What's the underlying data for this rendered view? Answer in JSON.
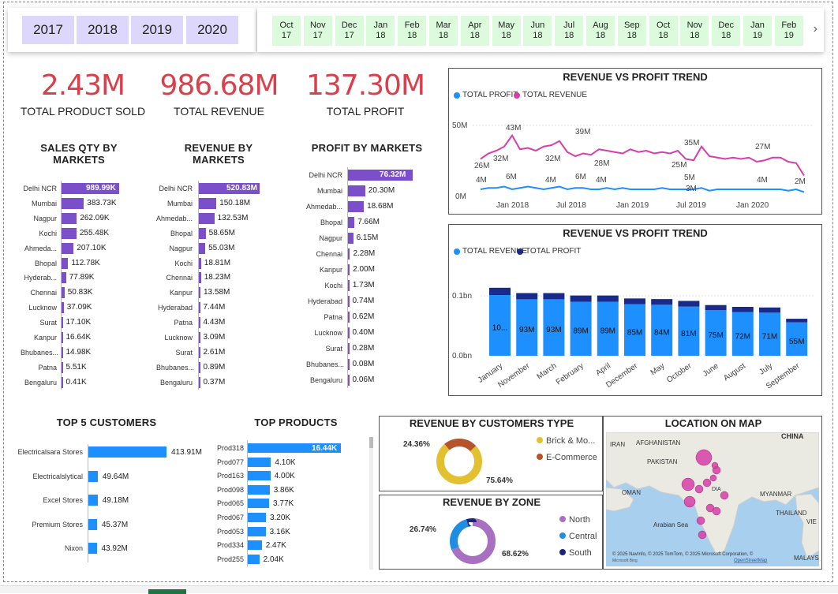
{
  "years": [
    "2017",
    "2018",
    "2019",
    "2020"
  ],
  "months": [
    [
      "Oct",
      "17"
    ],
    [
      "Nov",
      "17"
    ],
    [
      "Dec",
      "17"
    ],
    [
      "Jan",
      "18"
    ],
    [
      "Feb",
      "18"
    ],
    [
      "Mar",
      "18"
    ],
    [
      "Apr",
      "18"
    ],
    [
      "May",
      "18"
    ],
    [
      "Jun",
      "18"
    ],
    [
      "Jul",
      "18"
    ],
    [
      "Aug",
      "18"
    ],
    [
      "Sep",
      "18"
    ],
    [
      "Oct",
      "18"
    ],
    [
      "Nov",
      "18"
    ],
    [
      "Dec",
      "18"
    ],
    [
      "Jan",
      "19"
    ],
    [
      "Feb",
      "19"
    ]
  ],
  "kpis": [
    {
      "value": "2.43M",
      "label": "TOTAL PRODUCT SOLD"
    },
    {
      "value": "986.68M",
      "label": "TOTAL REVENUE"
    },
    {
      "value": "137.30M",
      "label": "TOTAL PROFIT"
    }
  ],
  "sales_qty": {
    "title": "SALES QTY BY MARKETS",
    "items": [
      [
        "Delhi NCR",
        "989.99K",
        989.99
      ],
      [
        "Mumbai",
        "383.73K",
        383.73
      ],
      [
        "Nagpur",
        "262.09K",
        262.09
      ],
      [
        "Kochi",
        "255.48K",
        255.48
      ],
      [
        "Ahmeda...",
        "207.10K",
        207.1
      ],
      [
        "Bhopal",
        "112.78K",
        112.78
      ],
      [
        "Hyderab...",
        "77.89K",
        77.89
      ],
      [
        "Chennai",
        "50.83K",
        50.83
      ],
      [
        "Lucknow",
        "37.09K",
        37.09
      ],
      [
        "Surat",
        "17.10K",
        17.1
      ],
      [
        "Kanpur",
        "16.64K",
        16.64
      ],
      [
        "Bhubanes...",
        "14.98K",
        14.98
      ],
      [
        "Patna",
        "5.51K",
        5.51
      ],
      [
        "Bengaluru",
        "0.41K",
        0.41
      ]
    ]
  },
  "revenue_markets": {
    "title": "REVENUE BY MARKETS",
    "items": [
      [
        "Delhi NCR",
        "520.83M",
        520.83
      ],
      [
        "Mumbai",
        "150.18M",
        150.18
      ],
      [
        "Ahmedab...",
        "132.53M",
        132.53
      ],
      [
        "Bhopal",
        "58.65M",
        58.65
      ],
      [
        "Nagpur",
        "55.03M",
        55.03
      ],
      [
        "Kochi",
        "18.81M",
        18.81
      ],
      [
        "Chennai",
        "18.23M",
        18.23
      ],
      [
        "Kanpur",
        "13.58M",
        13.58
      ],
      [
        "Hyderabad",
        "7.44M",
        7.44
      ],
      [
        "Patna",
        "4.43M",
        4.43
      ],
      [
        "Lucknow",
        "3.09M",
        3.09
      ],
      [
        "Surat",
        "2.61M",
        2.61
      ],
      [
        "Bhubanes...",
        "0.89M",
        0.89
      ],
      [
        "Bengaluru",
        "0.37M",
        0.37
      ]
    ]
  },
  "profit_markets": {
    "title": "PROFIT BY MARKETS",
    "items": [
      [
        "Delhi NCR",
        "76.32M",
        76.32
      ],
      [
        "Mumbai",
        "20.30M",
        20.3
      ],
      [
        "Ahmedab...",
        "18.68M",
        18.68
      ],
      [
        "Bhopal",
        "7.66M",
        7.66
      ],
      [
        "Nagpur",
        "6.15M",
        6.15
      ],
      [
        "Chennai",
        "2.28M",
        2.28
      ],
      [
        "Kanpur",
        "2.00M",
        2.0
      ],
      [
        "Kochi",
        "1.73M",
        1.73
      ],
      [
        "Hyderabad",
        "0.74M",
        0.74
      ],
      [
        "Patna",
        "0.62M",
        0.62
      ],
      [
        "Lucknow",
        "0.40M",
        0.4
      ],
      [
        "Surat",
        "0.28M",
        0.28
      ],
      [
        "Bhubanes...",
        "0.08M",
        0.08
      ],
      [
        "Bengaluru",
        "0.06M",
        0.06
      ]
    ]
  },
  "trend_line": {
    "title": "REVENUE VS PROFIT TREND",
    "legend": [
      "TOTAL PROFIT",
      "TOTAL REVENUE"
    ],
    "yticks": [
      "50M",
      "0M"
    ],
    "xticks": [
      "Jan 2018",
      "Jul 2018",
      "Jan 2019",
      "Jul 2019",
      "Jan 2020"
    ],
    "revenue_labels": [
      "26M",
      "32M",
      "43M",
      "32M",
      "39M",
      "28M",
      "35M",
      "25M",
      "27M",
      "2M"
    ],
    "profit_labels": [
      "4M",
      "6M",
      "4M",
      "6M",
      "4M",
      "5M",
      "3M",
      "4M"
    ]
  },
  "trend_bar": {
    "title": "REVENUE VS PROFIT TREND",
    "legend": [
      "TOTAL REVENUE",
      "TOTAL PROFIT"
    ],
    "yticks": [
      "0.1bn",
      "0.0bn"
    ],
    "months": [
      "January",
      "November",
      "March",
      "February",
      "April",
      "December",
      "May",
      "October",
      "June",
      "August",
      "July",
      "September"
    ],
    "labels": [
      "10...",
      "93M",
      "93M",
      "89M",
      "89M",
      "85M",
      "84M",
      "81M",
      "75M",
      "72M",
      "71M",
      "55M"
    ],
    "revenue": [
      100,
      93,
      93,
      89,
      89,
      85,
      84,
      81,
      75,
      72,
      71,
      55
    ],
    "profit": [
      14,
      12,
      12,
      12,
      12,
      11,
      11,
      11,
      10,
      10,
      10,
      7
    ]
  },
  "top_customers": {
    "title": "TOP 5 CUSTOMERS",
    "items": [
      [
        "Electricalsara Stores",
        "413.91M",
        413.91
      ],
      [
        "Electricalslytical",
        "49.64M",
        49.64
      ],
      [
        "Excel Stores",
        "49.18M",
        49.18
      ],
      [
        "Premium Stores",
        "45.37M",
        45.37
      ],
      [
        "Nixon",
        "43.92M",
        43.92
      ]
    ]
  },
  "top_products": {
    "title": "TOP PRODUCTS",
    "items": [
      [
        "Prod318",
        "16.44K",
        16.44
      ],
      [
        "Prod077",
        "4.10K",
        4.1
      ],
      [
        "Prod163",
        "4.00K",
        4.0
      ],
      [
        "Prod098",
        "3.86K",
        3.86
      ],
      [
        "Prod065",
        "3.77K",
        3.77
      ],
      [
        "Prod067",
        "3.20K",
        3.2
      ],
      [
        "Prod053",
        "3.16K",
        3.16
      ],
      [
        "Prod334",
        "2.47K",
        2.47
      ],
      [
        "Prod255",
        "2.04K",
        2.04
      ]
    ]
  },
  "customer_type": {
    "title": "REVENUE BY CUSTOMERS TYPE",
    "slices": [
      [
        "Brick & Mo...",
        75.64,
        "#e3c030"
      ],
      [
        "E-Commerce",
        24.36,
        "#b5532a"
      ]
    ],
    "labels": [
      "24.36%",
      "75.64%"
    ]
  },
  "zone": {
    "title": "REVENUE BY ZONE",
    "slices": [
      [
        "North",
        68.62,
        "#a870c0"
      ],
      [
        "Central",
        26.74,
        "#1e8fe0"
      ],
      [
        "South",
        4.64,
        "#1a237e"
      ]
    ],
    "labels": [
      "26.74%",
      "68.62%"
    ]
  },
  "map": {
    "title": "LOCATION ON MAP",
    "labels": [
      "CHINA",
      "IRAN",
      "AFGHANISTAN",
      "PAKISTAN",
      "OMAN",
      "MYANMAR",
      "THAILAND",
      "Arabian Sea",
      "MALAYSIA",
      "VIE",
      "DIA"
    ],
    "attribution": "© 2025 NavInfo, © 2025 TomTom, © 2025 Microsoft Corporation, ©",
    "osm": "OpenStreetMap",
    "bing": "Microsoft Bing"
  },
  "colors": {
    "purple": "#7b4fc9",
    "blue": "#1e8fff",
    "navy": "#1a2a8a",
    "kpi": "#d9404b",
    "pink": "#d63fa8"
  }
}
